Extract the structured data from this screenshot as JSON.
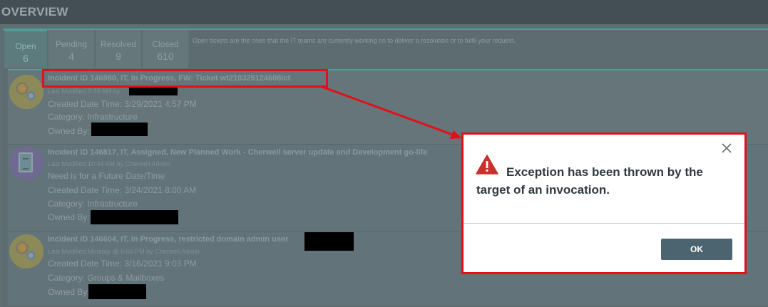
{
  "header": {
    "title": "OVERVIEW"
  },
  "tabs": [
    {
      "label": "Open",
      "count": "6"
    },
    {
      "label": "Pending",
      "count": "4"
    },
    {
      "label": "Resolved",
      "count": "9"
    },
    {
      "label": "Closed",
      "count": "610"
    }
  ],
  "tab_description": "Open tickets are the ones that the IT teams are currently working on to deliver a resolution or to fulfil your request.",
  "tickets": [
    {
      "title": "Incident ID 146980, IT, In Progress, FW: Ticket wt210325124608ict",
      "modified": "Last Modified 9:49 AM by",
      "created": "Created Date Time: 3/29/2021 4:57 PM",
      "category": "Category: Infrastructure",
      "owned": "Owned By:"
    },
    {
      "title": "Incident ID 146817, IT, Assigned, New Planned Work - Cherwell server update and Development go-life",
      "modified": "Last Modified 10:44 AM by Cherwell Admin",
      "note": "Need is for a Future Date/Time",
      "created": "Created Date Time: 3/24/2021 8:00 AM",
      "category": "Category: Infrastructure",
      "owned": "Owned By:"
    },
    {
      "title": "Incident ID 146604, IT, In Progress, restricted domain admin user",
      "modified": "Last Modified Monday @ 6:00 PM by Cherwell Admin",
      "created": "Created Date Time: 3/16/2021 9:03 PM",
      "category": "Category: Groups & Mailboxes",
      "owned": "Owned By:"
    }
  ],
  "dialog": {
    "message": "Exception has been thrown by the target of an invocation.",
    "ok_label": "OK",
    "icon": "warning-triangle-icon",
    "close_icon": "close-icon"
  },
  "colors": {
    "highlight": "#e0111a",
    "button": "#4b6470",
    "accent": "#4f9c98"
  }
}
